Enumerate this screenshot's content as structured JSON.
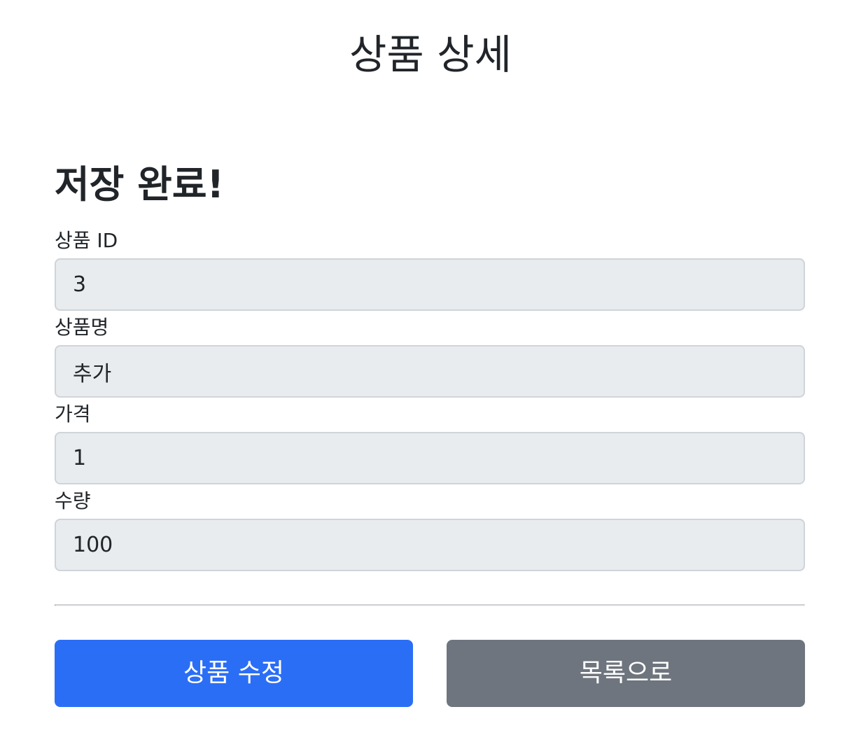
{
  "header": {
    "title": "상품 상세"
  },
  "status": {
    "message": "저장 완료!"
  },
  "form": {
    "fields": [
      {
        "label": "상품 ID",
        "value": "3"
      },
      {
        "label": "상품명",
        "value": "추가"
      },
      {
        "label": "가격",
        "value": "1"
      },
      {
        "label": "수량",
        "value": "100"
      }
    ]
  },
  "actions": {
    "edit_label": "상품 수정",
    "list_label": "목록으로"
  },
  "colors": {
    "primary": "#2b6ef6",
    "secondary": "#6e757e",
    "input_bg": "#e9ecef",
    "input_border": "#ced4da"
  }
}
